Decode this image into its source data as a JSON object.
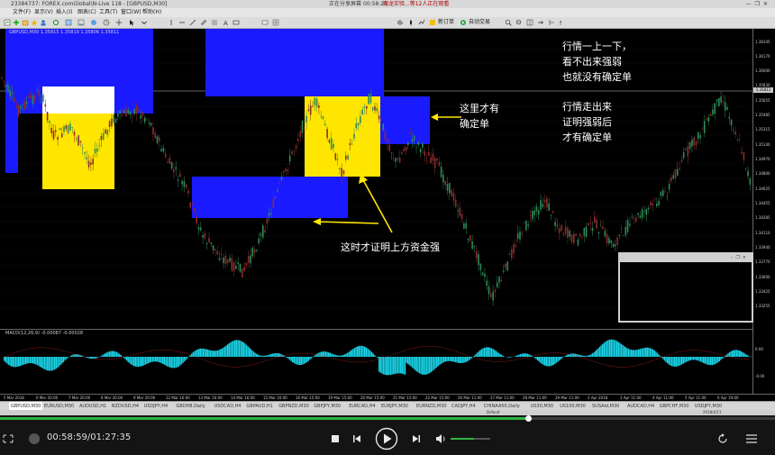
{
  "titlebar": {
    "title": "23384737: FOREX.comGlobal\\N-Live 118 - [GBPUSD,M30]",
    "recording": "正在分享屏幕",
    "rec_time": "00:58:21",
    "speaker": "翔龙实验...等12人正在观看"
  },
  "menu": [
    "文件(F)",
    "显示(V)",
    "插入(I)",
    "图表(C)",
    "工具(T)",
    "窗口(W)",
    "帮助(H)"
  ],
  "toolbar": {
    "new_order": "新订单",
    "autotrade": "自动交易"
  },
  "chart": {
    "symbol_label": "GBPUSD,M30  1.35815 1.35819 1.35806 1.35811",
    "price_ticks": [
      "1.36345",
      "1.36170",
      "1.36000",
      "1.35830",
      "1.35655",
      "1.35485",
      "1.35315",
      "1.35140",
      "1.34970",
      "1.34800",
      "1.34625",
      "1.34455",
      "1.34285",
      "1.34110",
      "1.33940",
      "1.33770",
      "1.33600",
      "1.33425",
      "1.33255"
    ],
    "current_price": "1.35811",
    "annotations": {
      "note_top_line1": "行情一上一下，",
      "note_top_line2": "看不出来强弱",
      "note_top_line3": "也就没有确定单",
      "note_mid_line1": "行情走出来",
      "note_mid_line2": "证明强弱后",
      "note_mid_line3": "才有确定单",
      "note_here_line1": "这里才有",
      "note_here_line2": "确定单",
      "note_bottom": "这时才证明上方资金强"
    },
    "colors": {
      "blue_zone": "#1a1aff",
      "yellow_zone": "#ffe600",
      "annotation_arrow": "#ffe600",
      "macd_hist": "#19d2e6",
      "bull": "#2e8b57",
      "bear": "#8b2e2e"
    }
  },
  "macd": {
    "label": "MACD(12,26,9) -0.00087 -0.00028",
    "ticks": [
      "0.00",
      "-0.00"
    ]
  },
  "dates": [
    "5 Mar 2018",
    "6 Mar 20:00",
    "7 Mar 20:00",
    "8 Mar 20:00",
    "9 Mar 20:00",
    "12 Mar 16:00",
    "13 Mar 16:00",
    "14 Mar 16:00",
    "15 Mar 16:00",
    "16 Mar 15:00",
    "19 Mar 15:00",
    "20 Mar 15:00",
    "21 Mar 15:00",
    "22 Mar 15:00",
    "26 Mar 11:00",
    "27 Mar 11:00",
    "28 Mar 11:00",
    "29 Mar 11:00",
    "2 Apr 2018",
    "3 Apr 11:00",
    "4 Apr 11:00",
    "5 Apr 11:00",
    "6 Apr 19:00"
  ],
  "symbol_tabs": [
    "GBPUSD,M30",
    "EURUSD,M30",
    "AUDUSD,H1",
    "NZDUSD,H4",
    "USDJPY,H4",
    "GBDH8,Daily",
    "USDCAD,H4",
    "GBPAUD,H1",
    "GBPNZD,M30",
    "GBPJPY,M30",
    "EURCAD,H4",
    "EURJPY,M30",
    "EURNZD,M30",
    "CADJPY,H4",
    "CHINAA50,Daily",
    "US30,M30",
    "US100,M30",
    "SUSAid,M30",
    "AUDCAD,H4",
    "GBPCHF,M30",
    "USDJPY,M30"
  ],
  "status": {
    "left": "Default",
    "right": "2018/4/11"
  },
  "player": {
    "time": "00:58:59/01:27:35",
    "progress": 0.683,
    "volume": 0.6
  }
}
